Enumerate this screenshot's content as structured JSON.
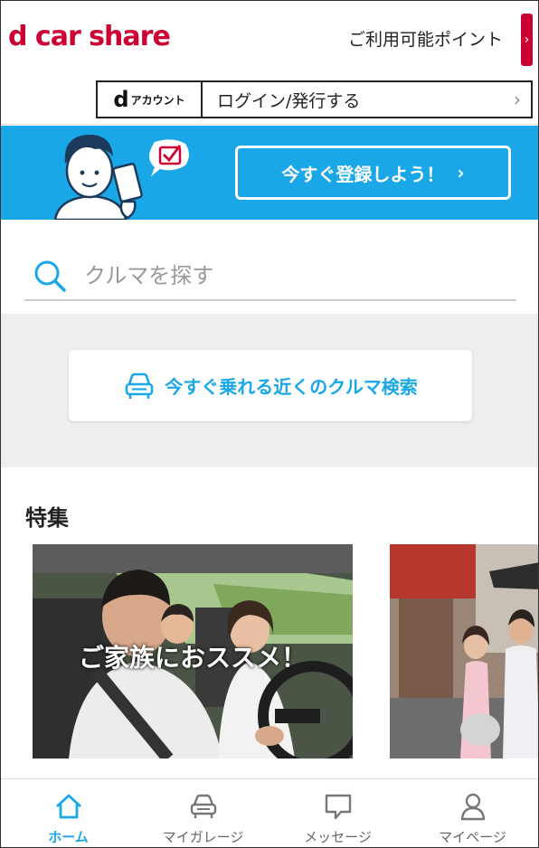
{
  "header": {
    "logo_text": "d car share",
    "points_label": "ご利用可能ポイント",
    "points_tab_arrow": "›"
  },
  "login": {
    "d_mark": "d",
    "account_label": "アカウント",
    "login_label": "ログイン/発行する",
    "chevron": "›"
  },
  "banner": {
    "register_label": "今すぐ登録しよう！",
    "register_arrow": "›"
  },
  "search": {
    "placeholder": "クルマを探す"
  },
  "nearby": {
    "label": "今すぐ乗れる近くのクルマ検索"
  },
  "features": {
    "title": "特集",
    "cards": [
      {
        "caption": "ご家族におススメ！"
      }
    ]
  },
  "bottom_nav": {
    "items": [
      {
        "label": "ホーム",
        "icon": "home-icon",
        "active": true
      },
      {
        "label": "マイガレージ",
        "icon": "car-icon",
        "active": false
      },
      {
        "label": "メッセージ",
        "icon": "message-icon",
        "active": false
      },
      {
        "label": "マイページ",
        "icon": "user-icon",
        "active": false
      }
    ]
  },
  "colors": {
    "brand_red": "#cc0033",
    "accent_blue": "#1aa7e8"
  }
}
